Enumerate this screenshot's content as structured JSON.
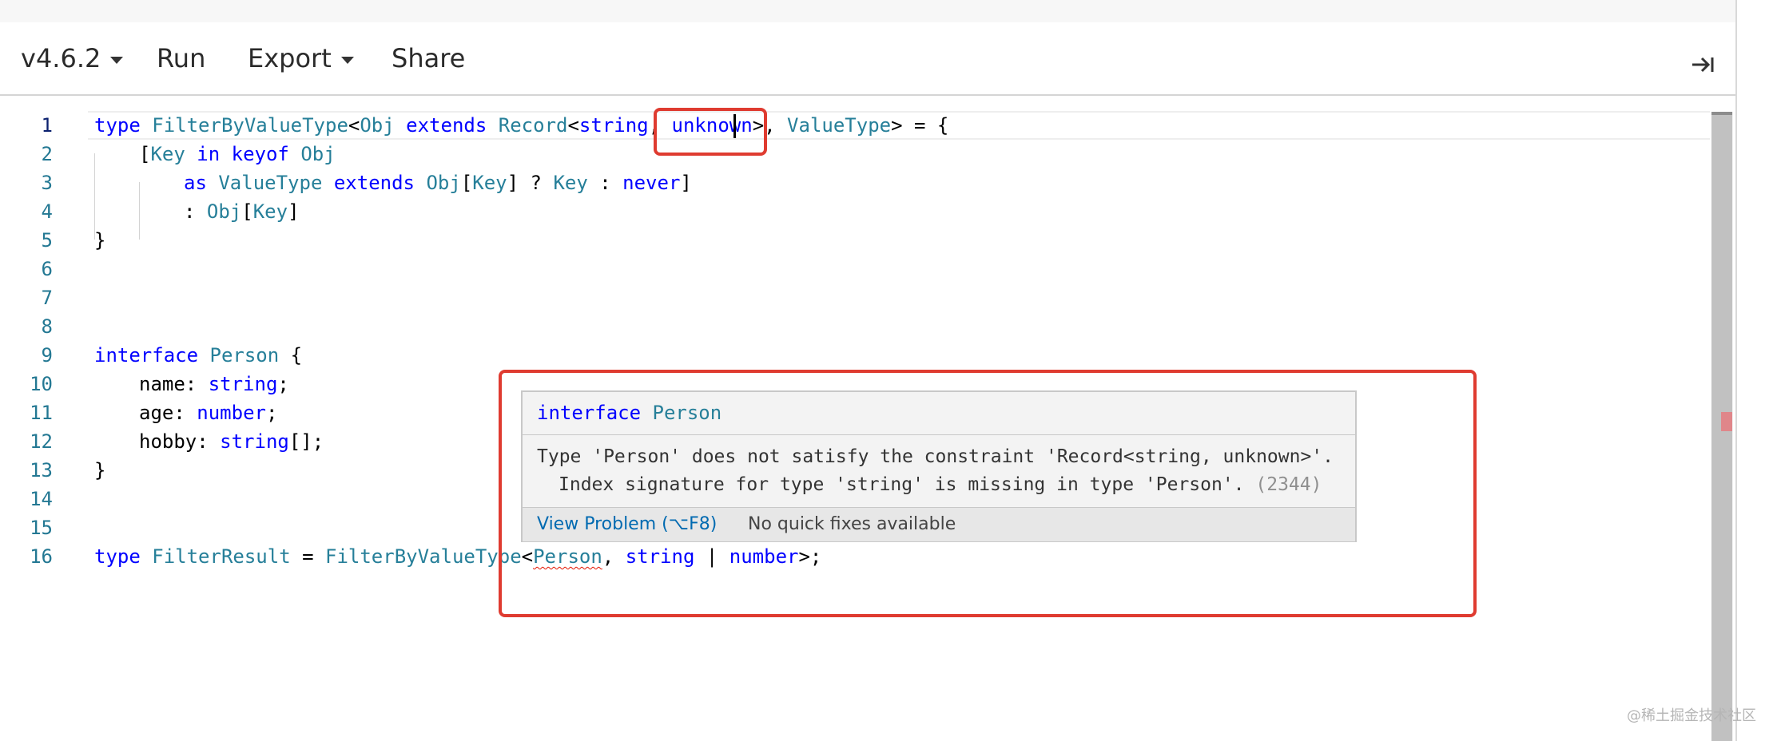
{
  "toolbar": {
    "version_label": "v4.6.2",
    "run_label": "Run",
    "export_label": "Export",
    "share_label": "Share"
  },
  "editor": {
    "line_numbers": [
      "1",
      "2",
      "3",
      "4",
      "5",
      "6",
      "7",
      "8",
      "9",
      "10",
      "11",
      "12",
      "13",
      "14",
      "15",
      "16"
    ],
    "active_line": 1,
    "lines": {
      "l1": [
        {
          "t": "type ",
          "c": "kw"
        },
        {
          "t": "FilterByValueType",
          "c": "ty"
        },
        {
          "t": "<",
          "c": "pl"
        },
        {
          "t": "Obj",
          "c": "ty"
        },
        {
          "t": " ",
          "c": "pl"
        },
        {
          "t": "extends",
          "c": "kw"
        },
        {
          "t": " ",
          "c": "pl"
        },
        {
          "t": "Record",
          "c": "ty"
        },
        {
          "t": "<",
          "c": "pl"
        },
        {
          "t": "string",
          "c": "kw"
        },
        {
          "t": ", ",
          "c": "pl"
        },
        {
          "t": "unknown",
          "c": "kw"
        },
        {
          "t": ">, ",
          "c": "pl"
        },
        {
          "t": "ValueType",
          "c": "ty"
        },
        {
          "t": "> = {",
          "c": "pl"
        }
      ],
      "l2": [
        {
          "t": "[",
          "c": "pl"
        },
        {
          "t": "Key",
          "c": "ty"
        },
        {
          "t": " ",
          "c": "pl"
        },
        {
          "t": "in",
          "c": "kw"
        },
        {
          "t": " ",
          "c": "pl"
        },
        {
          "t": "keyof",
          "c": "kw"
        },
        {
          "t": " ",
          "c": "pl"
        },
        {
          "t": "Obj",
          "c": "ty"
        }
      ],
      "l3": [
        {
          "t": "as",
          "c": "kw"
        },
        {
          "t": " ",
          "c": "pl"
        },
        {
          "t": "ValueType",
          "c": "ty"
        },
        {
          "t": " ",
          "c": "pl"
        },
        {
          "t": "extends",
          "c": "kw"
        },
        {
          "t": " ",
          "c": "pl"
        },
        {
          "t": "Obj",
          "c": "ty"
        },
        {
          "t": "[",
          "c": "pl"
        },
        {
          "t": "Key",
          "c": "ty"
        },
        {
          "t": "] ? ",
          "c": "pl"
        },
        {
          "t": "Key",
          "c": "ty"
        },
        {
          "t": " : ",
          "c": "pl"
        },
        {
          "t": "never",
          "c": "kw"
        },
        {
          "t": "]",
          "c": "pl"
        }
      ],
      "l4": [
        {
          "t": ": ",
          "c": "pl"
        },
        {
          "t": "Obj",
          "c": "ty"
        },
        {
          "t": "[",
          "c": "pl"
        },
        {
          "t": "Key",
          "c": "ty"
        },
        {
          "t": "]",
          "c": "pl"
        }
      ],
      "l5": [
        {
          "t": "}",
          "c": "pl"
        }
      ],
      "l9": [
        {
          "t": "interface",
          "c": "kw"
        },
        {
          "t": " ",
          "c": "pl"
        },
        {
          "t": "Person",
          "c": "ty"
        },
        {
          "t": " {",
          "c": "pl"
        }
      ],
      "l10": [
        {
          "t": "name",
          "c": "pl"
        },
        {
          "t": ": ",
          "c": "pl"
        },
        {
          "t": "string",
          "c": "kw"
        },
        {
          "t": ";",
          "c": "pl"
        }
      ],
      "l11": [
        {
          "t": "age",
          "c": "pl"
        },
        {
          "t": ": ",
          "c": "pl"
        },
        {
          "t": "number",
          "c": "kw"
        },
        {
          "t": ";",
          "c": "pl"
        }
      ],
      "l12": [
        {
          "t": "hobby",
          "c": "pl"
        },
        {
          "t": ": ",
          "c": "pl"
        },
        {
          "t": "string",
          "c": "kw"
        },
        {
          "t": "[];",
          "c": "pl"
        }
      ],
      "l13": [
        {
          "t": "}",
          "c": "pl"
        }
      ],
      "l16": [
        {
          "t": "type",
          "c": "kw"
        },
        {
          "t": " ",
          "c": "pl"
        },
        {
          "t": "FilterResult",
          "c": "ty"
        },
        {
          "t": " = ",
          "c": "pl"
        },
        {
          "t": "FilterByValueType",
          "c": "ty"
        },
        {
          "t": "<",
          "c": "pl"
        },
        {
          "t": "Person",
          "c": "ty",
          "err": true
        },
        {
          "t": ", ",
          "c": "pl"
        },
        {
          "t": "string",
          "c": "kw"
        },
        {
          "t": " | ",
          "c": "pl"
        },
        {
          "t": "number",
          "c": "kw"
        },
        {
          "t": ">;",
          "c": "pl"
        }
      ]
    }
  },
  "hover": {
    "keyword": "interface",
    "type_name": "Person",
    "message_line1": "Type 'Person' does not satisfy the constraint 'Record<string, unknown>'.",
    "message_line2": "Index signature for type 'string' is missing in type 'Person'.",
    "error_code": "(2344)",
    "view_problem_label": "View Problem (⌥F8)",
    "no_quick_fixes_label": "No quick fixes available"
  },
  "watermark": "@稀土掘金技术社区",
  "colors": {
    "keyword": "#0000ff",
    "type": "#267f99",
    "line_number": "#237893",
    "error_squiggle": "#e51400",
    "highlight_box": "#df3b30",
    "link": "#006ab1"
  },
  "icons": {
    "collapse": "arrow-right-to-bar-icon",
    "dropdown": "caret-down-icon"
  }
}
